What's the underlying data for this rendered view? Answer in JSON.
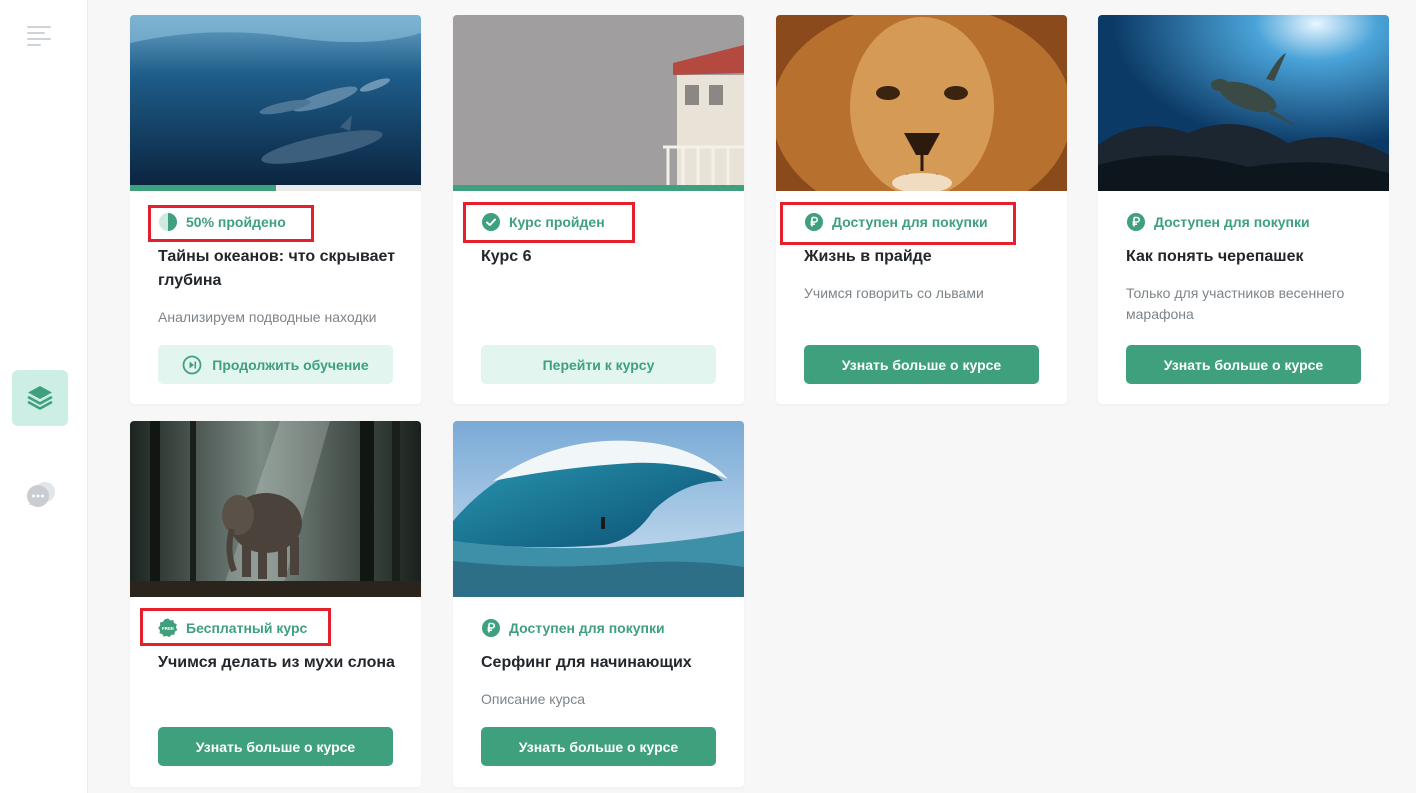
{
  "sidebar": {
    "menu_icon": "hamburger-menu-icon",
    "courses_icon": "layers-icon",
    "chat_icon": "chat-bubble-icon"
  },
  "colors": {
    "accent": "#3fa07e",
    "accent_light": "#e2f5ef",
    "highlight": "#e3202c"
  },
  "courses": [
    {
      "status": "50% пройдено",
      "status_icon": "half-circle-progress-icon",
      "progress": 0.5,
      "title": "Тайны океанов: что скрывает глубина",
      "description": "Анализируем подводные находки",
      "button": "Продолжить обучение",
      "button_icon": "play-next-icon",
      "image": "dolphins-underwater"
    },
    {
      "status": "Курс пройден",
      "status_icon": "check-circle-icon",
      "progress": 1.0,
      "title": "Курс 6",
      "description": "",
      "button": "Перейти к курсу",
      "image": "lifeguard-tower"
    },
    {
      "status": "Доступен для покупки",
      "status_icon": "ruble-coin-icon",
      "title": "Жизнь в прайде",
      "description": "Учимся говорить со львами",
      "button": "Узнать больше о курсе",
      "image": "lion-face"
    },
    {
      "status": "Доступен для покупки",
      "status_icon": "ruble-coin-icon",
      "title": "Как понять черепашек",
      "description": "Только для участников весеннего марафона",
      "button": "Узнать больше о курсе",
      "image": "sea-turtle"
    },
    {
      "status": "Бесплатный курс",
      "status_icon": "free-badge-icon",
      "free_badge_text": "FREE",
      "title": "Учимся делать из мухи слона",
      "description": "",
      "button": "Узнать больше о курсе",
      "image": "elephant-forest"
    },
    {
      "status": "Доступен для покупки",
      "status_icon": "ruble-coin-icon",
      "title": "Серфинг для начинающих",
      "description": "Описание курса",
      "button": "Узнать больше о курсе",
      "image": "surf-wave"
    }
  ]
}
